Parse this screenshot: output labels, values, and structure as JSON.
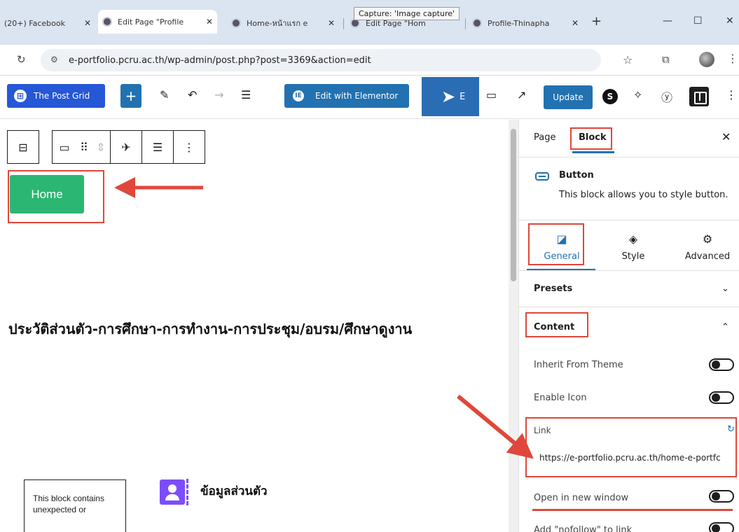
{
  "browser": {
    "tabs": [
      {
        "label": "(20+) Facebook"
      },
      {
        "label": "Edit Page \"Profile"
      },
      {
        "label": "Home-หน้าแรก e"
      },
      {
        "label": "Edit Page \"Hom"
      },
      {
        "label": "Profile-Thinapha"
      }
    ],
    "new_tab": "+",
    "window_controls": {
      "minimize": "—",
      "maximize": "☐",
      "close": "✕"
    },
    "tooltip": "Capture: 'Image capture'",
    "url": "e-portfolio.pcru.ac.th/wp-admin/post.php?post=3369&action=edit"
  },
  "toolbar": {
    "post_grid_label": "The Post Grid",
    "elementor_label": "Edit with Elementor",
    "blue_block_text": "E",
    "update_label": "Update",
    "s_label": "S"
  },
  "canvas": {
    "home_button": "Home",
    "heading": "ประวัติส่วนตัว-การศึกษา-การทำงาน-การประชุม/อบรม/ศึกษาดูงาน",
    "warning": "This block contains unexpected or",
    "profile_title": "ข้อมูลส่วนตัว"
  },
  "sidebar": {
    "tab_page": "Page",
    "tab_block": "Block",
    "close": "✕",
    "block_name": "Button",
    "block_desc": "This block allows you to style button.",
    "segments": {
      "general": "General",
      "style": "Style",
      "advanced": "Advanced"
    },
    "presets": "Presets",
    "content": "Content",
    "inherit_theme": "Inherit From Theme",
    "enable_icon": "Enable Icon",
    "link_label": "Link",
    "link_value": "https://e-portfolio.pcru.ac.th/home-e-portfc",
    "open_new_window": "Open in new window",
    "nofollow": "Add \"nofollow\" to link"
  },
  "colors": {
    "accent_blue": "#2271b1",
    "home_green": "#2bb673",
    "annotation_red": "#e0473a",
    "profile_purple": "#7c4dff"
  }
}
